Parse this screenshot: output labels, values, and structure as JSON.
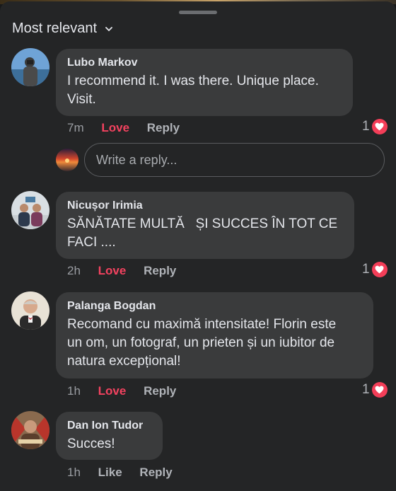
{
  "sort": {
    "label": "Most relevant",
    "icon": "chevron-down-icon"
  },
  "comments": [
    {
      "author": "Lubo Markov",
      "text_lines": [
        "I recommend it. I was there. Unique place.",
        "Visit."
      ],
      "time": "7m",
      "reaction_action": "Love",
      "reply_label": "Reply",
      "reaction_count": "1",
      "reaction_icon": "heart-icon"
    },
    {
      "author": "Nicușor Irimia",
      "text_lines": [
        "SĂNĂTATE MULTĂ   ȘI SUCCES ÎN TOT CE",
        "FACI ...."
      ],
      "time": "2h",
      "reaction_action": "Love",
      "reply_label": "Reply",
      "reaction_count": "1",
      "reaction_icon": "heart-icon"
    },
    {
      "author": "Palanga Bogdan",
      "text_lines": [
        "Recomand cu maximă intensitate! Florin este",
        "un om, un fotograf, un prieten și un iubitor de",
        "natura excepțional!"
      ],
      "time": "1h",
      "reaction_action": "Love",
      "reply_label": "Reply",
      "reaction_count": "1",
      "reaction_icon": "heart-icon"
    },
    {
      "author": "Dan Ion Tudor",
      "text_lines": [
        "Succes!"
      ],
      "time": "1h",
      "reaction_action": "Like",
      "reply_label": "Reply"
    }
  ],
  "reply_box": {
    "placeholder": "Write a reply..."
  },
  "colors": {
    "love": "#f3425f",
    "heart_badge": "#f33e58",
    "bubble": "#3a3b3c",
    "background": "#242526"
  }
}
